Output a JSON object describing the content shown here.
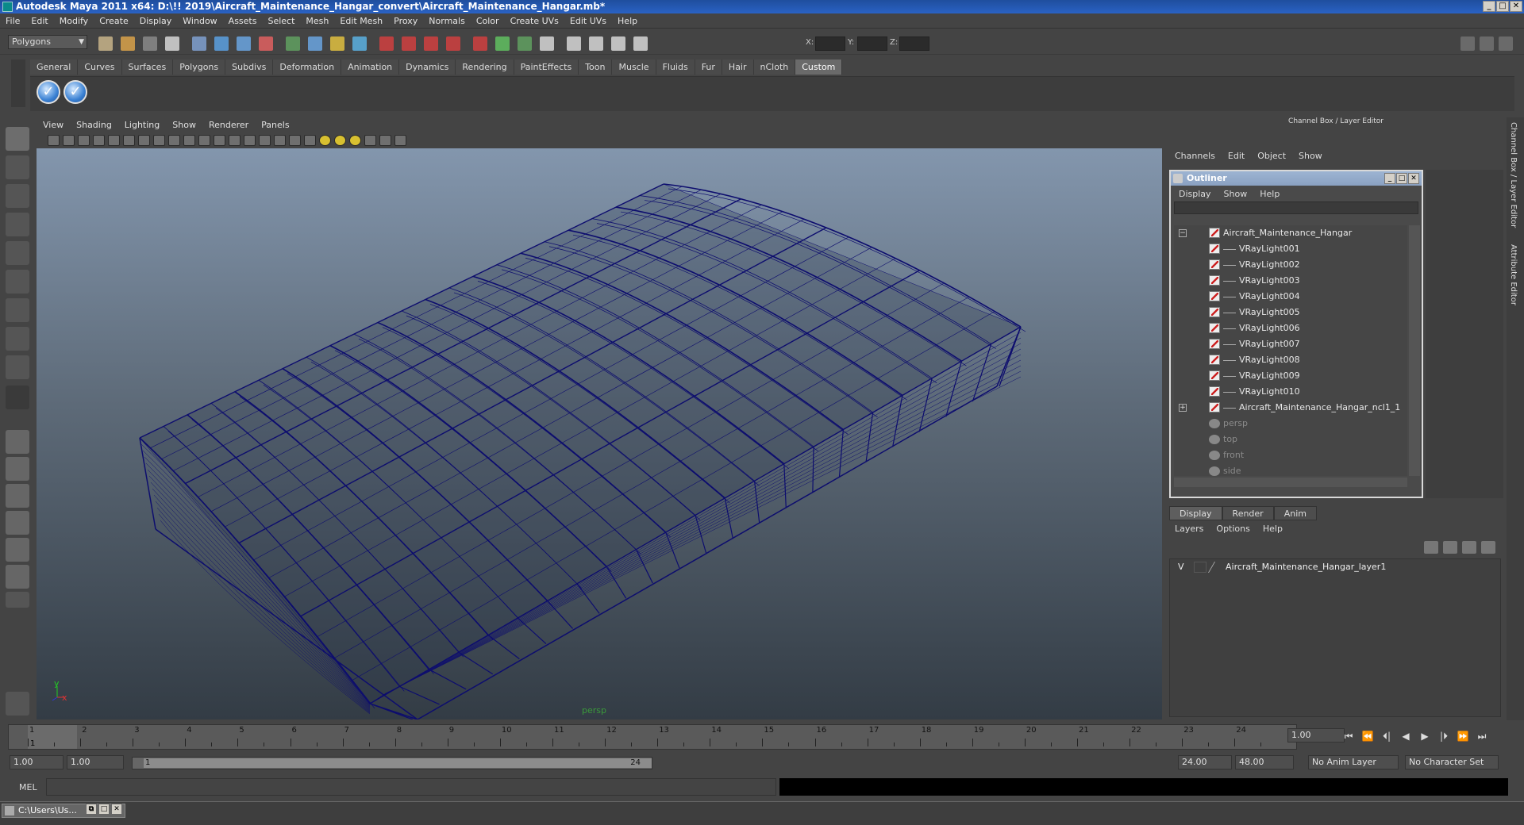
{
  "window": {
    "title": "Autodesk Maya 2011 x64: D:\\!! 2019\\Aircraft_Maintenance_Hangar_convert\\Aircraft_Maintenance_Hangar.mb*",
    "min": "_",
    "max": "□",
    "close": "✕"
  },
  "menubar": [
    "File",
    "Edit",
    "Modify",
    "Create",
    "Display",
    "Window",
    "Assets",
    "Select",
    "Mesh",
    "Edit Mesh",
    "Proxy",
    "Normals",
    "Color",
    "Create UVs",
    "Edit UVs",
    "Help"
  ],
  "statusline": {
    "mode": "Polygons",
    "x_label": "X:",
    "y_label": "Y:",
    "z_label": "Z:"
  },
  "shelf": {
    "tabs": [
      "General",
      "Curves",
      "Surfaces",
      "Polygons",
      "Subdivs",
      "Deformation",
      "Animation",
      "Dynamics",
      "Rendering",
      "PaintEffects",
      "Toon",
      "Muscle",
      "Fluids",
      "Fur",
      "Hair",
      "nCloth",
      "Custom"
    ],
    "active_tab": "Custom",
    "buttons": [
      {
        "icon": "checkmark-icon"
      },
      {
        "icon": "checkmark-icon"
      }
    ]
  },
  "panel_menu": [
    "View",
    "Shading",
    "Lighting",
    "Show",
    "Renderer",
    "Panels"
  ],
  "viewport": {
    "camera_label": "persp",
    "axis_y": "y",
    "axis_x": "x",
    "wire_color": "#0d0d6e",
    "bg_top": "#8396ad",
    "bg_bottom": "#333c45"
  },
  "channel_box": {
    "title": "Channel Box / Layer Editor",
    "menu": [
      "Channels",
      "Edit",
      "Object",
      "Show"
    ]
  },
  "outliner": {
    "title": "Outliner",
    "menu": [
      "Display",
      "Show",
      "Help"
    ],
    "items": [
      {
        "label": "Aircraft_Maintenance_Hangar",
        "kind": "top",
        "expand": "−"
      },
      {
        "label": "VRayLight001",
        "kind": "light"
      },
      {
        "label": "VRayLight002",
        "kind": "light"
      },
      {
        "label": "VRayLight003",
        "kind": "light"
      },
      {
        "label": "VRayLight004",
        "kind": "light"
      },
      {
        "label": "VRayLight005",
        "kind": "light"
      },
      {
        "label": "VRayLight006",
        "kind": "light"
      },
      {
        "label": "VRayLight007",
        "kind": "light"
      },
      {
        "label": "VRayLight008",
        "kind": "light"
      },
      {
        "label": "VRayLight009",
        "kind": "light"
      },
      {
        "label": "VRayLight010",
        "kind": "light"
      },
      {
        "label": "Aircraft_Maintenance_Hangar_ncl1_1",
        "kind": "light",
        "expand": "+"
      },
      {
        "label": "persp",
        "kind": "cam"
      },
      {
        "label": "top",
        "kind": "cam"
      },
      {
        "label": "front",
        "kind": "cam"
      },
      {
        "label": "side",
        "kind": "cam"
      }
    ]
  },
  "layer_editor": {
    "tabs": [
      "Display",
      "Render",
      "Anim"
    ],
    "active_tab": "Display",
    "menu": [
      "Layers",
      "Options",
      "Help"
    ],
    "layers": [
      {
        "visible": "V",
        "name": "Aircraft_Maintenance_Hangar_layer1"
      }
    ]
  },
  "side_tabs": [
    "Channel Box / Layer Editor",
    "Attribute Editor"
  ],
  "timeline": {
    "ticks": [
      "1",
      "2",
      "3",
      "4",
      "5",
      "6",
      "7",
      "8",
      "9",
      "10",
      "11",
      "12",
      "13",
      "14",
      "15",
      "16",
      "17",
      "18",
      "19",
      "20",
      "21",
      "22",
      "23",
      "24"
    ],
    "current_frame_marker": "1",
    "current_time": "1.00"
  },
  "range": {
    "start": "1.00",
    "playback_start": "1.00",
    "slider_start": "1",
    "slider_end": "24",
    "playback_end": "24.00",
    "end": "48.00",
    "anim_layer": "No Anim Layer",
    "character_set": "No Character Set"
  },
  "playback_controls": [
    "⏮",
    "⏪",
    "⏴|",
    "◀",
    "▶",
    "|⏵",
    "⏩",
    "⏭"
  ],
  "mel": {
    "label": "MEL"
  },
  "taskbar": {
    "item": "C:\\Users\\Us..."
  }
}
